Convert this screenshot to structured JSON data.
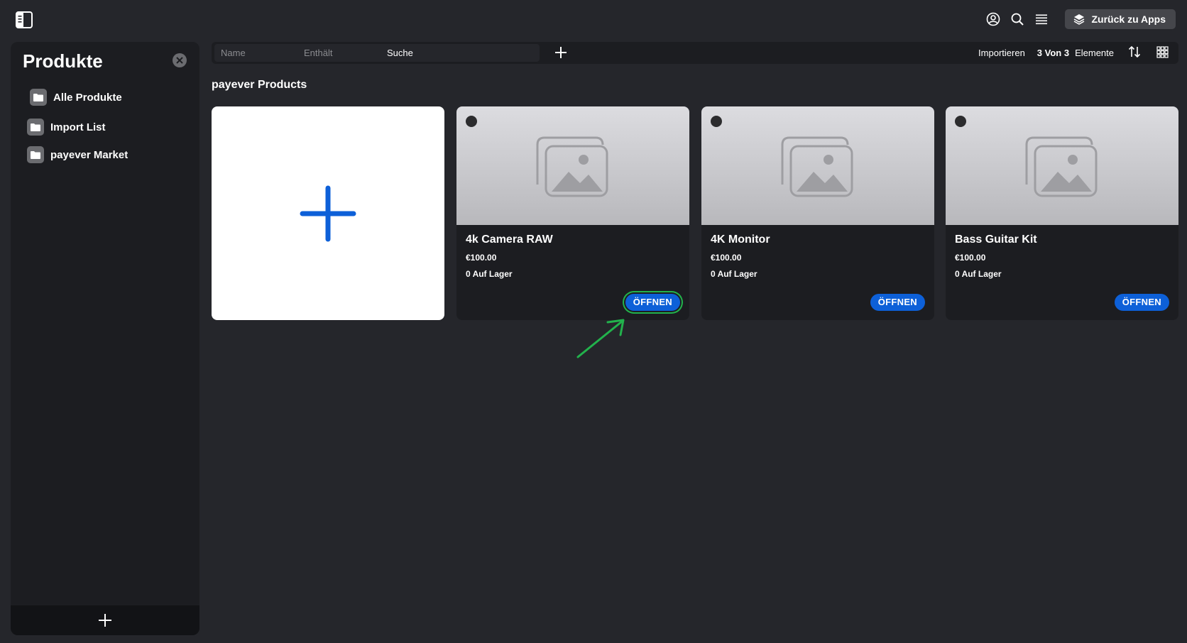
{
  "topbar": {
    "sidebar_toggle_icon": "sidebar-toggle-icon",
    "icons": [
      "account-icon",
      "search-icon",
      "menu-icon"
    ],
    "back_button_label": "Zurück zu Apps"
  },
  "sidebar": {
    "title": "Produkte",
    "items": [
      {
        "label": "Alle Produkte"
      },
      {
        "label": "Import List"
      },
      {
        "label": "payever Market"
      }
    ]
  },
  "toolbar": {
    "search": {
      "field_name": "Name",
      "field_contains": "Enthält",
      "field_search": "Suche"
    },
    "import_label": "Importieren",
    "count_label": "3 Von 3",
    "elements_label": "Elemente"
  },
  "main": {
    "group_title": "payever Products",
    "products": [
      {
        "name": "4k Camera RAW",
        "price": "€100.00",
        "stock": "0 Auf Lager",
        "open_label": "ÖFFNEN"
      },
      {
        "name": "4K Monitor",
        "price": "€100.00",
        "stock": "0 Auf Lager",
        "open_label": "ÖFFNEN"
      },
      {
        "name": "Bass Guitar Kit",
        "price": "€100.00",
        "stock": "0 Auf Lager",
        "open_label": "ÖFFNEN"
      }
    ]
  },
  "colors": {
    "background": "#25262b",
    "panel": "#1c1d21",
    "accent_blue": "#0d60d8",
    "highlight_green": "#22b24c"
  }
}
